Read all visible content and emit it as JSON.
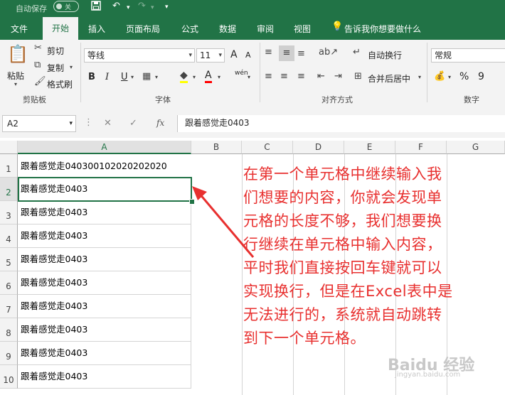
{
  "titlebar": {
    "autosave": "自动保存",
    "autosave_state": "关",
    "more": "▾"
  },
  "tabs": [
    "文件",
    "开始",
    "插入",
    "页面布局",
    "公式",
    "数据",
    "审阅",
    "视图"
  ],
  "tell_me": "告诉我你想要做什么",
  "clipboard": {
    "paste": "粘贴",
    "cut": "剪切",
    "copy": "复制",
    "format_painter": "格式刷",
    "group": "剪贴板"
  },
  "font": {
    "name": "等线",
    "size": "11",
    "bold": "B",
    "italic": "I",
    "underline": "U",
    "font_color_glyph": "A",
    "wen": "wén",
    "group": "字体",
    "grow": "A",
    "shrink": "A"
  },
  "alignment": {
    "wrap_text": "自动换行",
    "merge_center": "合并后居中",
    "group": "对齐方式"
  },
  "number": {
    "format": "常规",
    "percent": "%",
    "comma": "9",
    "group": "数字"
  },
  "formula_bar": {
    "name_box": "A2",
    "fx": "fx",
    "content": "跟着感觉走0403"
  },
  "columns": [
    "A",
    "B",
    "C",
    "D",
    "E",
    "F",
    "G"
  ],
  "rows": [
    {
      "num": "1",
      "a": "跟着感觉走040300102020202020"
    },
    {
      "num": "2",
      "a": "跟着感觉走0403"
    },
    {
      "num": "3",
      "a": "跟着感觉走0403"
    },
    {
      "num": "4",
      "a": "跟着感觉走0403"
    },
    {
      "num": "5",
      "a": "跟着感觉走0403"
    },
    {
      "num": "6",
      "a": "跟着感觉走0403"
    },
    {
      "num": "7",
      "a": "跟着感觉走0403"
    },
    {
      "num": "8",
      "a": "跟着感觉走0403"
    },
    {
      "num": "9",
      "a": "跟着感觉走0403"
    },
    {
      "num": "10",
      "a": "跟着感觉走0403"
    }
  ],
  "annotation": {
    "lines": [
      "在第一个单元格中继续输入我",
      "们想要的内容，你就会发现单",
      "元格的长度不够，我们想要换",
      "行继续在单元格中输入内容，",
      "平时我们直接按回车键就可以",
      "实现换行，但是在Excel表中是",
      "无法进行的，系统就自动跳转",
      "到下一个单元格。"
    ],
    "color": "#e8302f"
  },
  "watermark": {
    "brand": "Baidu 经验",
    "url": "jingyan.baidu.com"
  },
  "colors": {
    "accent": "#217346"
  }
}
